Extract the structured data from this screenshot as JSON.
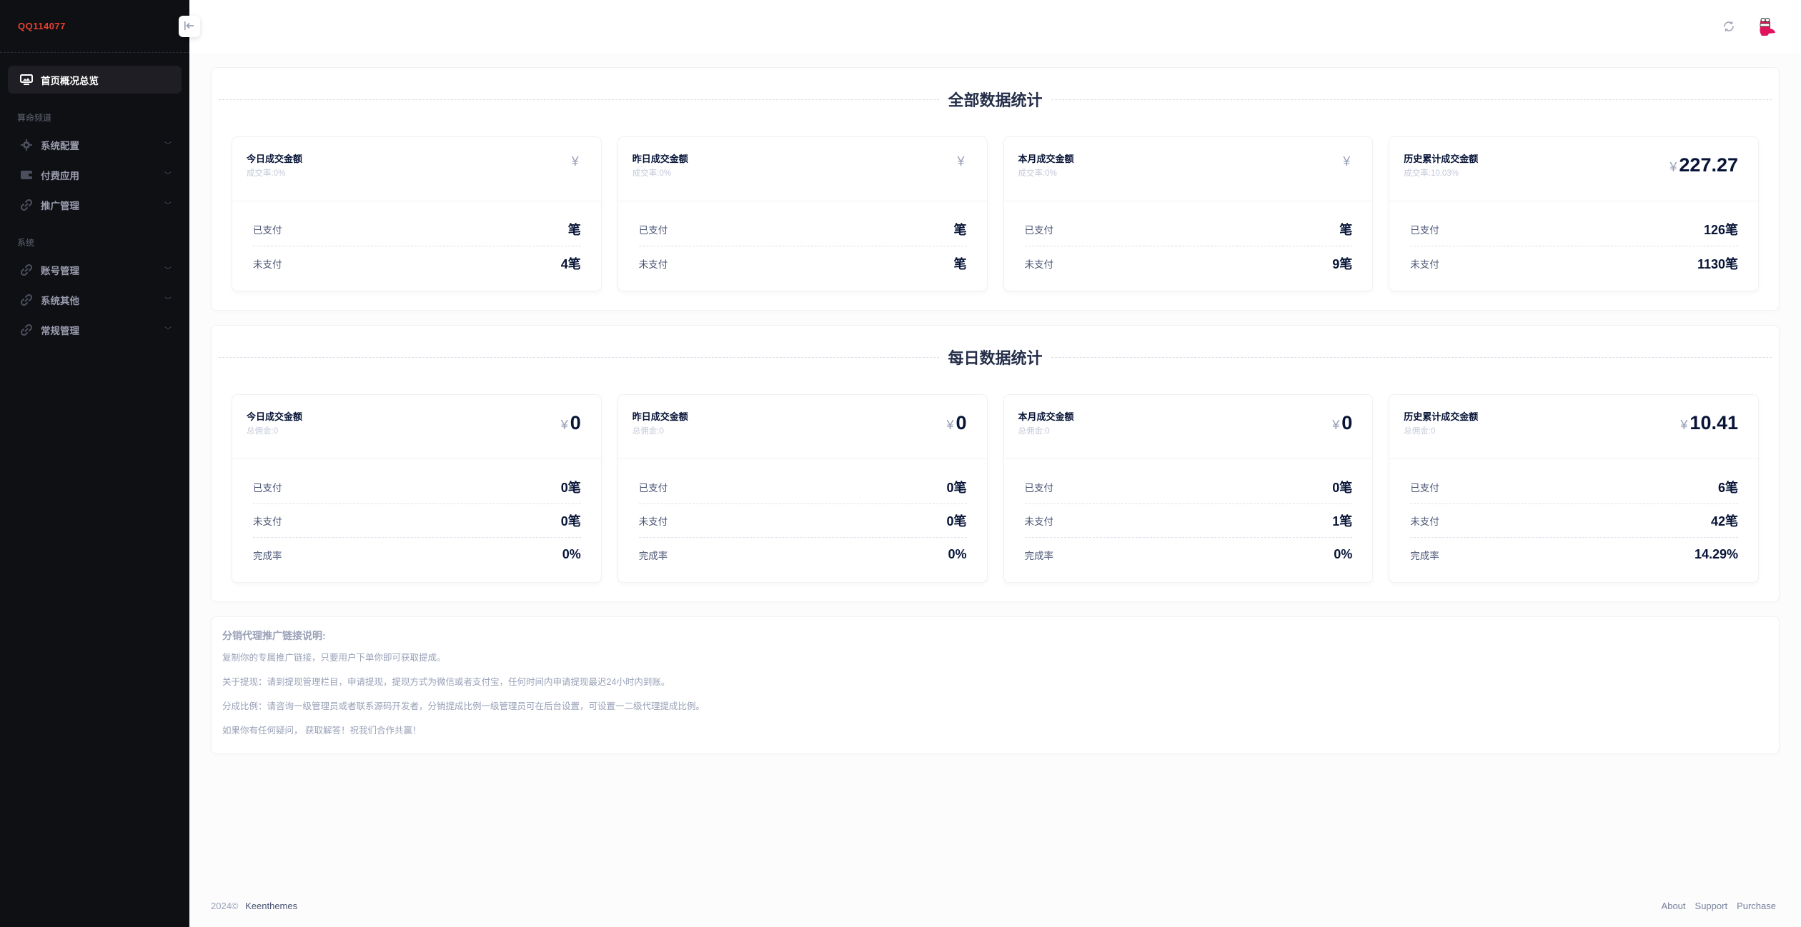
{
  "sidebar": {
    "brand": "QQ114077",
    "active_item": {
      "label": "首页概况总览",
      "icon": "monitor-icon"
    },
    "sections": [
      {
        "title": "算命频道",
        "items": [
          {
            "label": "系统配置",
            "icon": "gear-icon"
          },
          {
            "label": "付费应用",
            "icon": "wallet-icon"
          },
          {
            "label": "推广管理",
            "icon": "link-icon"
          }
        ]
      },
      {
        "title": "系统",
        "items": [
          {
            "label": "账号管理",
            "icon": "link-icon"
          },
          {
            "label": "系统其他",
            "icon": "link-icon"
          },
          {
            "label": "常规管理",
            "icon": "link-icon"
          }
        ]
      }
    ]
  },
  "header": {
    "toggle_icon": "collapse-left-icon",
    "refresh_icon": "refresh-icon",
    "avatar": "user-avatar"
  },
  "all_stats": {
    "title": "全部数据统计",
    "cards": [
      {
        "title": "今日成交金额",
        "subtitle": "成交率:0%",
        "currency": "¥",
        "amount": "",
        "rows": [
          {
            "label": "已支付",
            "value": "笔"
          },
          {
            "label": "未支付",
            "value": "4笔"
          }
        ]
      },
      {
        "title": "昨日成交金额",
        "subtitle": "成交率:0%",
        "currency": "¥",
        "amount": "",
        "rows": [
          {
            "label": "已支付",
            "value": "笔"
          },
          {
            "label": "未支付",
            "value": "笔"
          }
        ]
      },
      {
        "title": "本月成交金额",
        "subtitle": "成交率:0%",
        "currency": "¥",
        "amount": "",
        "rows": [
          {
            "label": "已支付",
            "value": "笔"
          },
          {
            "label": "未支付",
            "value": "9笔"
          }
        ]
      },
      {
        "title": "历史累计成交金额",
        "subtitle": "成交率:10.03%",
        "currency": "¥",
        "amount": "227.27",
        "rows": [
          {
            "label": "已支付",
            "value": "126笔"
          },
          {
            "label": "未支付",
            "value": "1130笔"
          }
        ]
      }
    ]
  },
  "daily_stats": {
    "title": "每日数据统计",
    "cards": [
      {
        "title": "今日成交金额",
        "subtitle": "总佣金:0",
        "currency": "¥",
        "amount": "0",
        "rows": [
          {
            "label": "已支付",
            "value": "0笔"
          },
          {
            "label": "未支付",
            "value": "0笔"
          },
          {
            "label": "完成率",
            "value": "0%"
          }
        ]
      },
      {
        "title": "昨日成交金额",
        "subtitle": "总佣金:0",
        "currency": "¥",
        "amount": "0",
        "rows": [
          {
            "label": "已支付",
            "value": "0笔"
          },
          {
            "label": "未支付",
            "value": "0笔"
          },
          {
            "label": "完成率",
            "value": "0%"
          }
        ]
      },
      {
        "title": "本月成交金额",
        "subtitle": "总佣金:0",
        "currency": "¥",
        "amount": "0",
        "rows": [
          {
            "label": "已支付",
            "value": "0笔"
          },
          {
            "label": "未支付",
            "value": "1笔"
          },
          {
            "label": "完成率",
            "value": "0%"
          }
        ]
      },
      {
        "title": "历史累计成交金额",
        "subtitle": "总佣金:0",
        "currency": "¥",
        "amount": "10.41",
        "rows": [
          {
            "label": "已支付",
            "value": "6笔"
          },
          {
            "label": "未支付",
            "value": "42笔"
          },
          {
            "label": "完成率",
            "value": "14.29%"
          }
        ]
      }
    ]
  },
  "notes": {
    "title": "分销代理推广链接说明:",
    "lines": [
      "复制你的专属推广链接，只要用户下单你即可获取提成。",
      "关于提现：请到提现管理栏目，申请提现，提现方式为微信或者支付宝，任何时间内申请提现最迟24小时内到账。",
      "分成比例：请咨询一级管理员或者联系源码开发者，分销提成比例一级管理员可在后台设置，可设置一二级代理提成比例。",
      "如果你有任何疑问， 获取解答！祝我们合作共赢！"
    ]
  },
  "footer": {
    "year": "2024©",
    "brand": "Keenthemes",
    "links": [
      "About",
      "Support",
      "Purchase"
    ]
  }
}
